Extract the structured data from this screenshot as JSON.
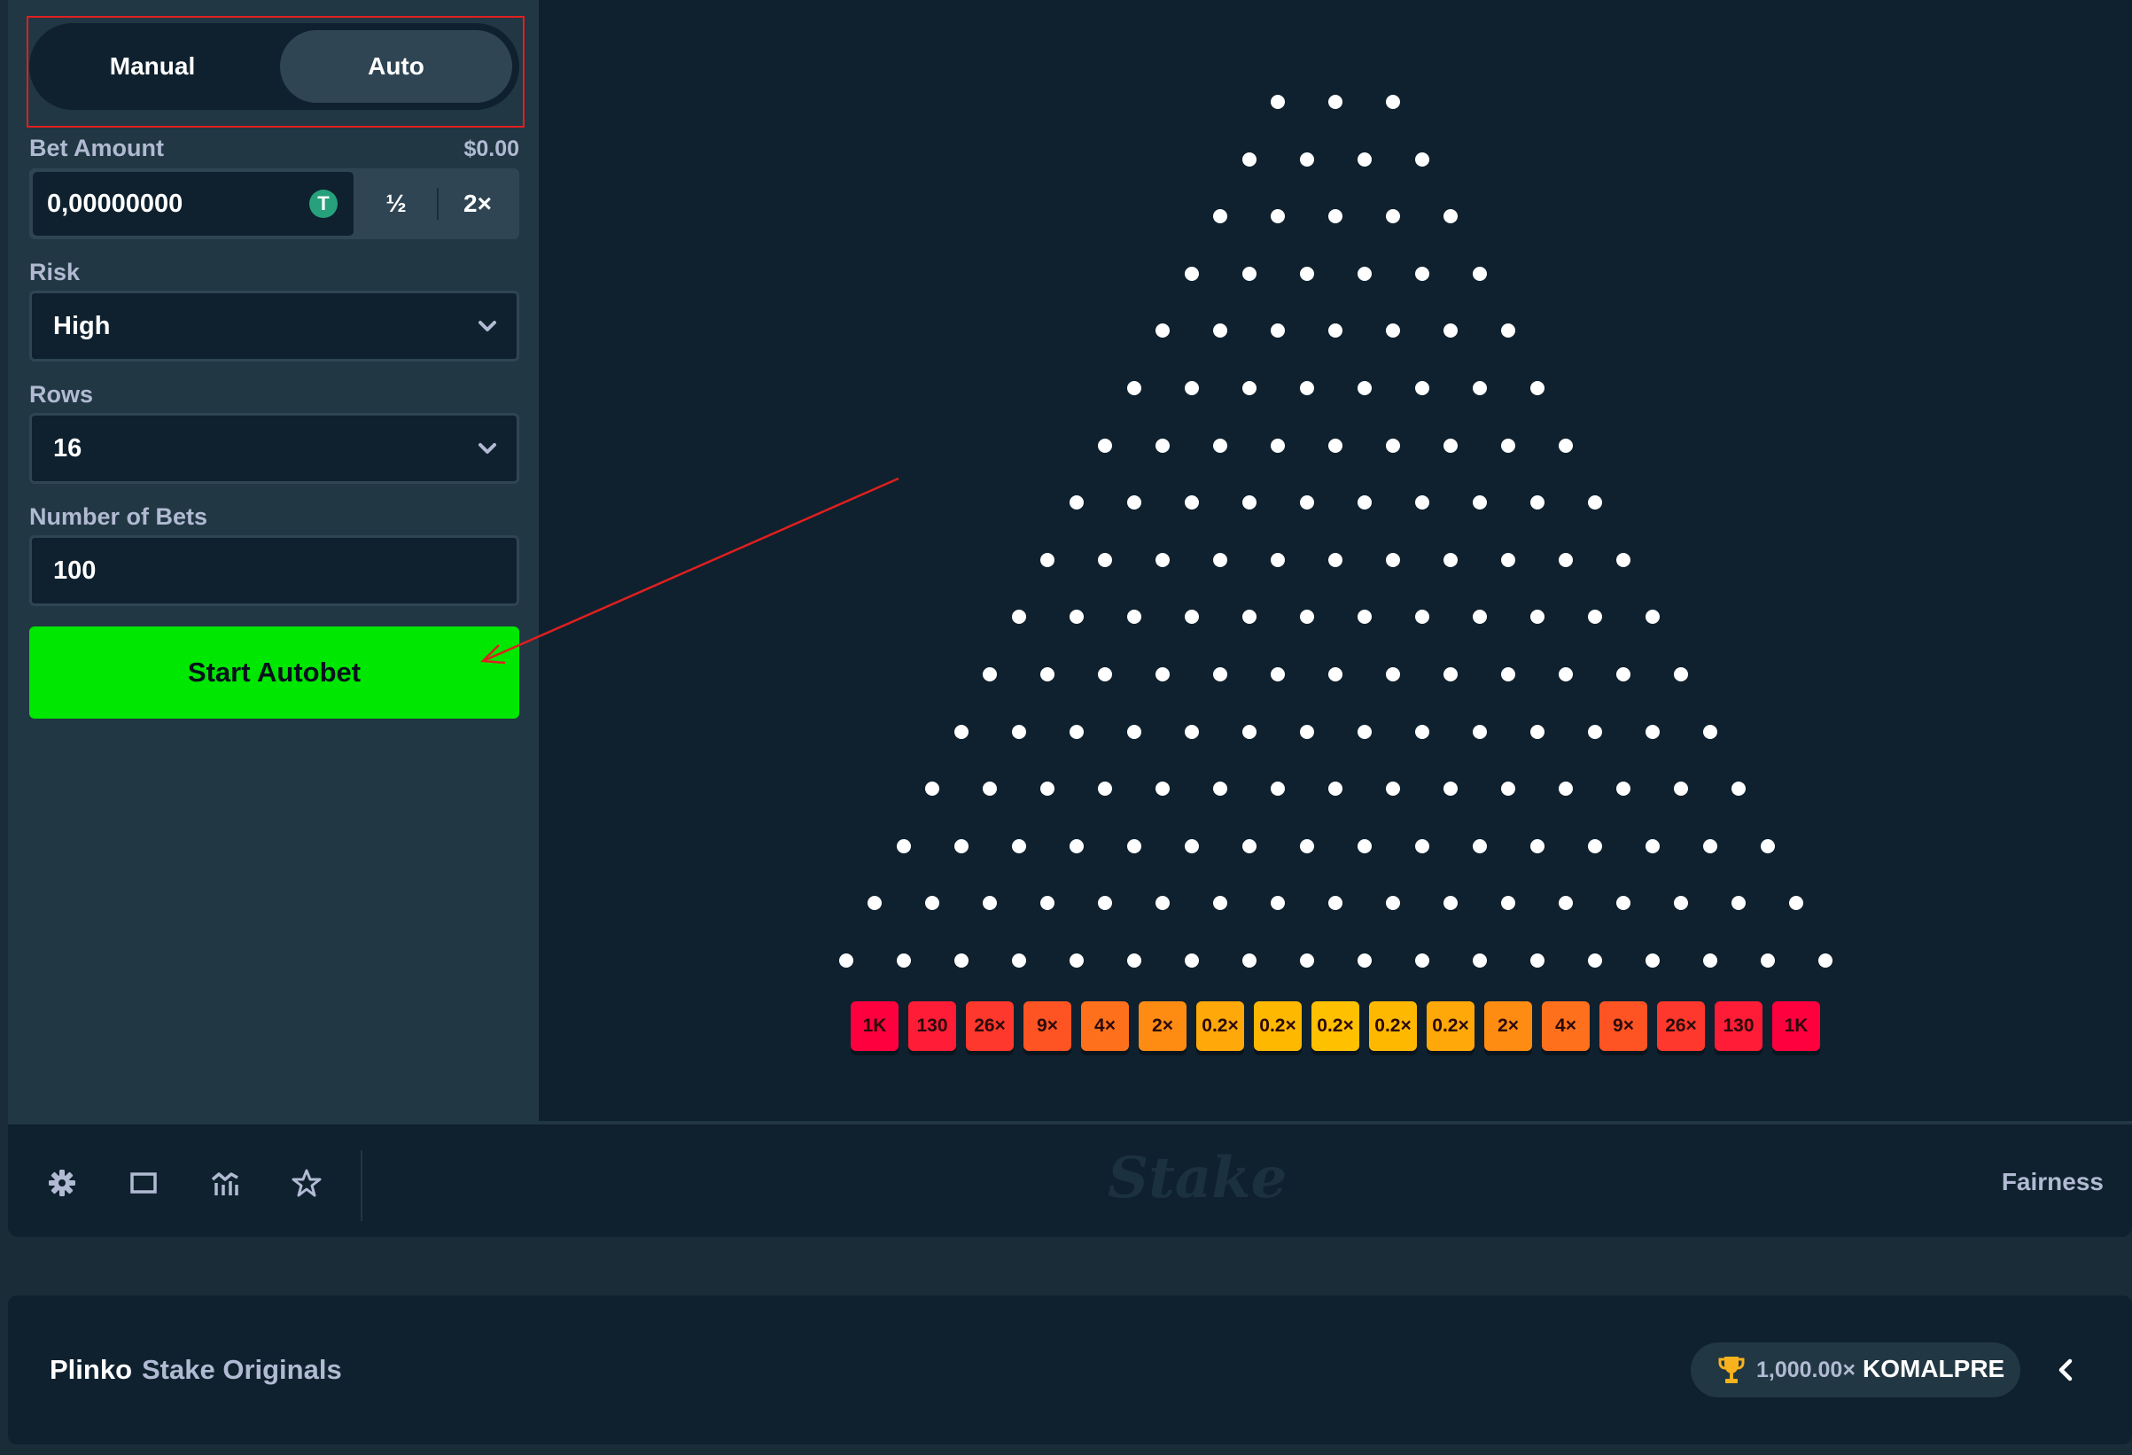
{
  "sidebar": {
    "mode_manual": "Manual",
    "mode_auto": "Auto",
    "bet_amount_label": "Bet Amount",
    "bet_amount_usd": "$0.00",
    "bet_amount_value": "0,00000000",
    "coin_symbol": "T",
    "half_label": "½",
    "double_label": "2×",
    "risk_label": "Risk",
    "risk_value": "High",
    "rows_label": "Rows",
    "rows_value": "16",
    "num_bets_label": "Number of Bets",
    "num_bets_value": "100",
    "start_button": "Start Autobet"
  },
  "board": {
    "peg_rows": 16,
    "buckets": [
      {
        "label": "1K",
        "color": "#ff003f"
      },
      {
        "label": "130",
        "color": "#fe1c36"
      },
      {
        "label": "26×",
        "color": "#fe382d"
      },
      {
        "label": "9×",
        "color": "#fe5424"
      },
      {
        "label": "4×",
        "color": "#fe701b"
      },
      {
        "label": "2×",
        "color": "#fe8c12"
      },
      {
        "label": "0.2×",
        "color": "#ffa809"
      },
      {
        "label": "0.2×",
        "color": "#ffb800"
      },
      {
        "label": "0.2×",
        "color": "#ffc000"
      },
      {
        "label": "0.2×",
        "color": "#ffb800"
      },
      {
        "label": "0.2×",
        "color": "#ffa809"
      },
      {
        "label": "2×",
        "color": "#fe8c12"
      },
      {
        "label": "4×",
        "color": "#fe701b"
      },
      {
        "label": "9×",
        "color": "#fe5424"
      },
      {
        "label": "26×",
        "color": "#fe382d"
      },
      {
        "label": "130",
        "color": "#fe1c36"
      },
      {
        "label": "1K",
        "color": "#ff003f"
      }
    ]
  },
  "footer": {
    "icons": [
      "settings-icon",
      "theatre-mode-icon",
      "stats-icon",
      "favourite-icon"
    ],
    "brand": "Stake",
    "fairness": "Fairness"
  },
  "info_bar": {
    "game_name": "Plinko",
    "provider": "Stake Originals",
    "record_multiplier": "1,000.00×",
    "record_user": "KOMALPRE"
  },
  "colors": {
    "accent_green": "#00e701",
    "panel": "#213743",
    "background": "#0f212e",
    "annotation_red": "#e01f1f"
  }
}
